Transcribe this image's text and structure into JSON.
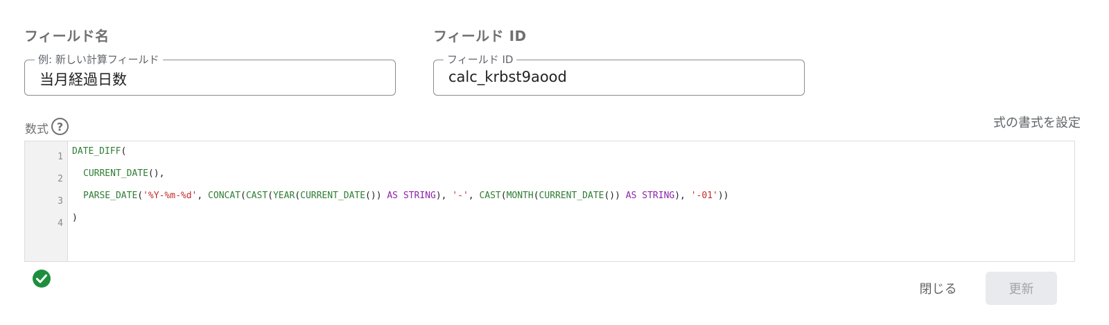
{
  "field_name": {
    "section_label": "フィールド名",
    "input_label": "例: 新しい計算フィールド",
    "value": "当月経過日数"
  },
  "field_id": {
    "section_label": "フィールド ID",
    "input_label": "フィールド ID",
    "value": "calc_krbst9aood"
  },
  "formula": {
    "label": "数式",
    "help_icon": "help-circle-icon",
    "format_link": "式の書式を設定",
    "line_numbers": [
      "1",
      "2",
      "3",
      "4"
    ],
    "code": {
      "line1": {
        "fn": "DATE_DIFF",
        "open": "("
      },
      "line2": {
        "fn": "CURRENT_DATE",
        "rest": "(),"
      },
      "line3": {
        "fn_parse_date": "PARSE_DATE",
        "p1": "(",
        "str_format": "'%Y-%m-%d'",
        "p2": ", ",
        "fn_concat": "CONCAT",
        "p3": "(",
        "fn_cast1": "CAST",
        "p4": "(",
        "fn_year": "YEAR",
        "p5": "(",
        "fn_current_date1": "CURRENT_DATE",
        "p6": "()) ",
        "kw_as1": "AS",
        "sp1": " ",
        "kw_string1": "STRING",
        "p7": "), ",
        "str_dash": "'-'",
        "p8": ", ",
        "fn_cast2": "CAST",
        "p9": "(",
        "fn_month": "MONTH",
        "p10": "(",
        "fn_current_date2": "CURRENT_DATE",
        "p11": "()) ",
        "kw_as2": "AS",
        "sp2": " ",
        "kw_string2": "STRING",
        "p12": "), ",
        "str_01": "'-01'",
        "p13": "))"
      },
      "line4": {
        "close": ")"
      }
    },
    "status_icon": "check-circle-icon",
    "colors": {
      "function": "#2e7d32",
      "string": "#c62828",
      "keyword": "#8e24aa",
      "valid": "#1e8e3e"
    }
  },
  "actions": {
    "close_label": "閉じる",
    "update_label": "更新"
  }
}
